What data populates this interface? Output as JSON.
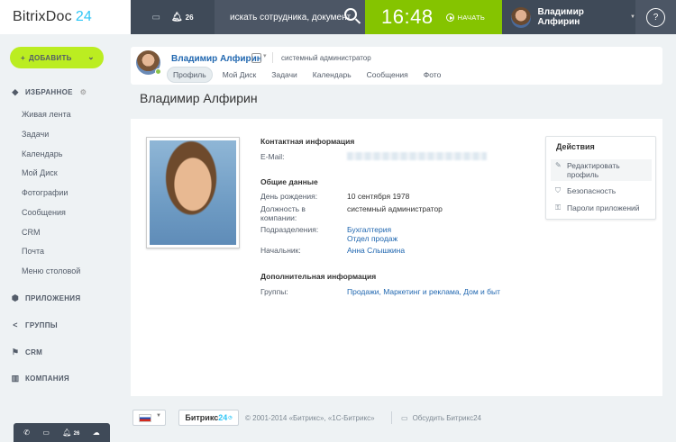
{
  "header": {
    "logo_text": "BitrixDoc",
    "logo_num": "24",
    "notifications_count": "26",
    "search_placeholder": "искать сотрудника, документ",
    "time": "16:48",
    "start_label": "НАЧАТЬ",
    "user_name": "Владимир Алфирин",
    "help_label": "?"
  },
  "sidebar": {
    "add_label": "ДОБАВИТЬ",
    "favorites_label": "ИЗБРАННОЕ",
    "items": [
      "Живая лента",
      "Задачи",
      "Календарь",
      "Мой Диск",
      "Фотографии",
      "Сообщения",
      "CRM",
      "Почта",
      "Меню столовой"
    ],
    "sections": [
      "ПРИЛОЖЕНИЯ",
      "ГРУППЫ",
      "CRM",
      "КОМПАНИЯ"
    ]
  },
  "bottombar": {
    "count": "26"
  },
  "profile_header": {
    "name": "Владимир Алфирин",
    "role": "системный администратор",
    "tabs": [
      "Профиль",
      "Мой Диск",
      "Задачи",
      "Календарь",
      "Сообщения",
      "Фото"
    ],
    "active_tab": "Профиль"
  },
  "page_title": "Владимир Алфирин",
  "profile": {
    "contact_heading": "Контактная информация",
    "email_label": "E-Mail:",
    "general_heading": "Общие данные",
    "birthday_label": "День рождения:",
    "birthday_value": "10 сентября 1978",
    "position_label": "Должность в компании:",
    "position_value": "системный администратор",
    "departments_label": "Подразделения:",
    "departments": [
      "Бухгалтерия",
      "Отдел продаж"
    ],
    "manager_label": "Начальник:",
    "manager_value": "Анна Слышкина",
    "additional_heading": "Дополнительная информация",
    "groups_label": "Группы:",
    "groups_value": "Продажи, Маркетинг и реклама, Дом и быт"
  },
  "actions": {
    "title": "Действия",
    "edit": "Редактировать профиль",
    "security": "Безопасность",
    "app_passwords": "Пароли приложений"
  },
  "footer": {
    "brand_text": "Битрикс",
    "brand_num": "24",
    "copyright": "© 2001-2014 «Битрикс», «1С-Битрикс»",
    "discuss": "Обсудить Битрикс24"
  },
  "colors": {
    "header_bg": "#3f4a58",
    "clock_green": "#85c400",
    "add_button": "#bbed21",
    "link_blue": "#2067b0",
    "brand_cyan": "#2fc6f6"
  }
}
